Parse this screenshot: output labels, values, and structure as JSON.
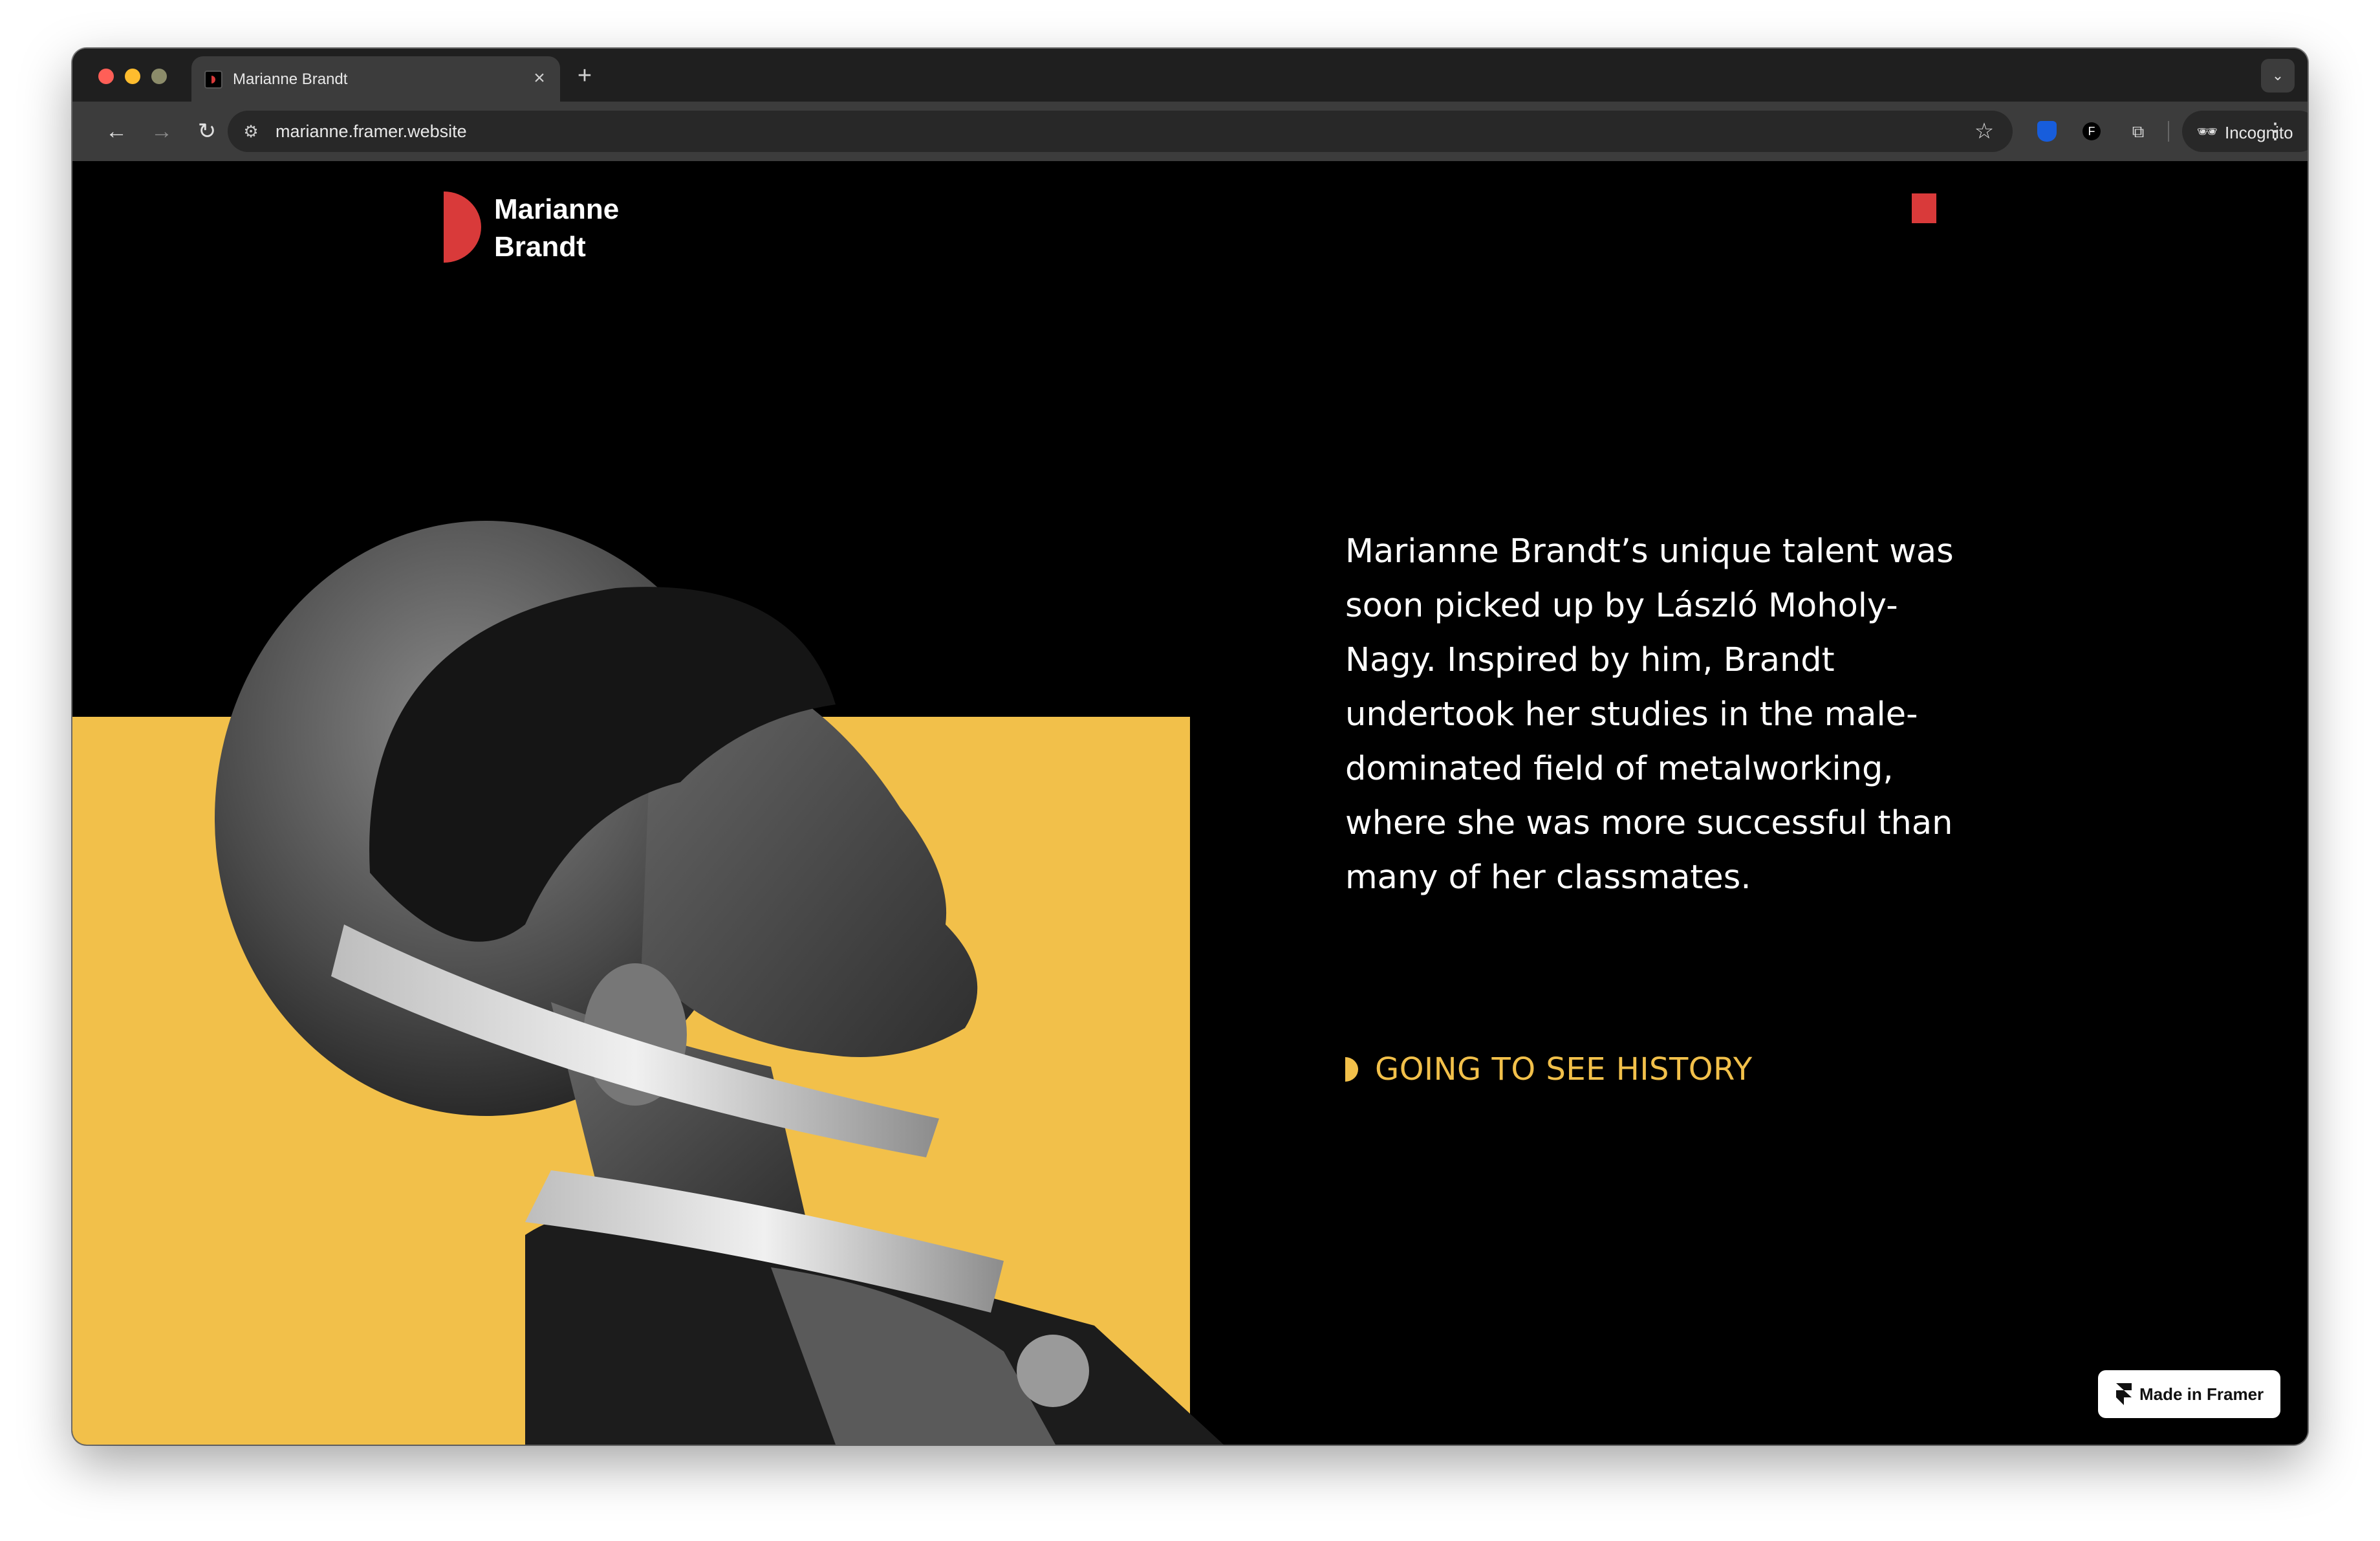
{
  "browser": {
    "tab_title": "Marianne Brandt",
    "tab_close": "×",
    "new_tab": "+",
    "tab_menu": "⌄",
    "url": "marianne.framer.website",
    "incognito_label": "Incognito",
    "nav_back": "←",
    "nav_forward": "→",
    "reload": "↻",
    "bookmark": "☆",
    "kebab": "⋮",
    "site_info": "⚙",
    "incognito_icon": "🕶",
    "extensions_icon": "⧉"
  },
  "site": {
    "logo_line1": "Marianne",
    "logo_line2": "Brandt",
    "body_text": "Marianne Brandt’s unique talent was soon picked up by László Moholy-Nagy. Inspired by him, Brandt undertook her studies in the male-dominated field of metalworking, where she was more successful than many of her classmates.",
    "cta_label": "GOING TO SEE HISTORY",
    "badge_label": "Made in Framer"
  },
  "colors": {
    "accent_red": "#d93a3a",
    "accent_yellow": "#f2c04a",
    "background": "#000000"
  }
}
